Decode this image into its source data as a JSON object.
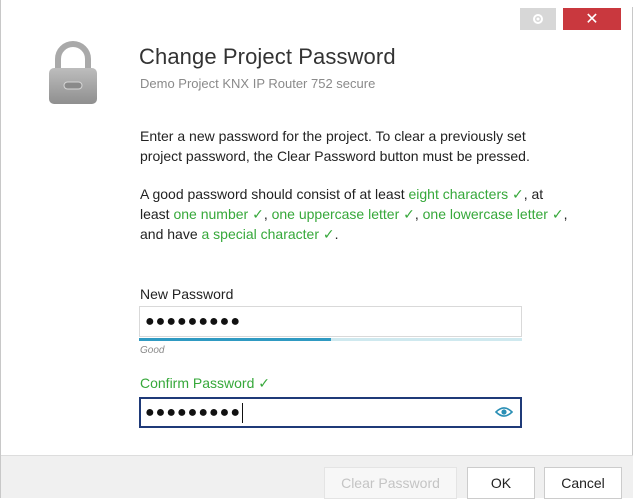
{
  "window": {
    "gear_icon": "gear-icon",
    "close_glyph": "✕"
  },
  "header": {
    "title": "Change Project Password",
    "subtitle": "Demo Project KNX IP Router 752 secure"
  },
  "instructions": {
    "text": "Enter a new password for the project. To clear a previously set project password, the Clear Password button must be pressed."
  },
  "requirements": {
    "t1": "A good password should consist of at least ",
    "r1": "eight characters ✓",
    "t2": ", at least ",
    "r2": "one number ✓",
    "t3": ", ",
    "r3": "one uppercase letter ✓",
    "t4": ", ",
    "r4": "one lowercase letter ✓",
    "t5": ", and have ",
    "r5": "a special character ✓",
    "t6": "."
  },
  "new_password": {
    "label": "New Password",
    "value": "●●●●●●●●●",
    "strength_label": "Good",
    "strength_fraction": 0.5
  },
  "confirm_password": {
    "label": "Confirm Password ✓",
    "value": "●●●●●●●●●"
  },
  "footer": {
    "clear_label": "Clear Password",
    "ok_label": "OK",
    "cancel_label": "Cancel"
  },
  "colors": {
    "accent_green": "#36a83a",
    "strength_bar": "#2f9ac2",
    "close_button": "#c9383e",
    "focus_border": "#1f3a78"
  }
}
